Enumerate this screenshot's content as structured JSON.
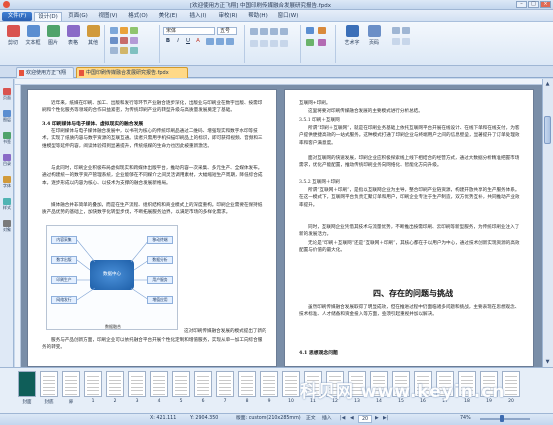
{
  "window": {
    "title": "[欢迎使用方正飞翔] 中国印刷传媒融合发展研究报告.fpdx"
  },
  "menu": {
    "file": "文件(F)",
    "tabs": [
      "设计(D)",
      "页面(G)",
      "视图(V)",
      "格式(O)",
      "美化(E)",
      "插入(I)",
      "审校(R)",
      "帮助(H)",
      "窗口(W)"
    ],
    "active_index": 0
  },
  "ribbon": {
    "buttons": [
      "剪切",
      "文本框",
      "图片",
      "表格",
      "其他"
    ],
    "font_name": "宋体",
    "font_size": "五号",
    "format": [
      "B",
      "I",
      "U",
      "A"
    ],
    "right_buttons": [
      "艺术字",
      "页码"
    ]
  },
  "doctabs": [
    {
      "label": "欢迎使用方正飞翔",
      "active": false
    },
    {
      "label": "中国印刷传媒融合发展研究报告.fpdx",
      "active": true
    }
  ],
  "leftpanel": [
    "页面",
    "图层",
    "书签",
    "目录",
    "字体",
    "样式",
    "对象"
  ],
  "page_left": {
    "intro": "近年来，纸媒在印刷、加工、出版和发行等环节产业融合逐步深化，出版业与印刷业在数字出版、按需印刷和个性化服务等领域的合作日益紧密，为传统印刷产业的转型升级与高质量发展奠定了基础。",
    "h_3_4": "3.4 印刷媒体与电子媒体、虚拟现实的融合发展",
    "p1": "在印刷媒体与电子媒体融合发展中，以书刊为核心的传统印刷品通过二维码、增强现实和数字水印等技术，实现了纸质内容与数字资源的互联互通。读者只需用手机扫描印刷品上的标识，即可获得视频、音频和三维模型等延伸内容，阅读体验得到显著提升，传统纸媒的生命力也因此被重新激活。",
    "p2": "与此同时，印刷企业积极布局虚拟现实和跨媒体出版平台，推动内容一次采集、多元生产、全媒体发布。通过构建统一的数字资产管理系统，企业能够在不同媒介之间灵活调用素材，大幅缩短生产周期，降低综合成本，逐步形成以内容为核心、以技术为支撑的融合发展新格局。",
    "p3": "媒体融合并非简单的叠加，而是在生产流程、组织结构和商业模式上的深度重构。印刷企业需要在保持纸质产品优势的基础上，加快数字化转型步伐，不断拓展服务边界，以满足市场的多样化需求。",
    "caption": "数据融合",
    "p4": "这对印刷传媒融合发展的模式提出了新的要求，需要产业链上下游协同推进。",
    "p5": "服务与产品创新方面，印刷企业可以依托融合平台开展个性化定制和增值服务，实现从单一加工向综合服务的转变。"
  },
  "diagram": {
    "center": "数据中心",
    "nodes": [
      "内容采集",
      "数字出版",
      "印刷生产",
      "网络发行",
      "移动终端",
      "数据分析",
      "用户服务",
      "增值应用"
    ]
  },
  "page_right": {
    "top": "互联网+印刷。",
    "p0": "这里将要对印刷传媒融合发展的主要模式进行分析总结。",
    "h_1": "3.5.1 印刷＋互联网",
    "p1": "所谓“印刷＋互联网”，就是在印刷业务基础上依托互联网平台开展在线设计、在线下单和在线支付，为客户提供便捷高效的一站式服务。这种模式打通了印刷企业与终端用户之间的信息壁垒，显著提升了订单处理效率和客户满意度。",
    "p2": "面对互联网的快速发展，印刷企业应积极探索线上线下相结合的经营方式，通过大数据分析精准把握市场需求，优化产能配置，推动传统印刷业务向网络化、智能化方向升级。",
    "h_2": "3.5.2 互联网＋印刷",
    "p3": "所谓“互联网＋印刷”，是指以互联网企业为主导，整合印刷产业链资源，构建开放共享的生产服务体系。在这一模式下，互联网平台负责汇聚订单和用户，印刷企业专注于生产制造，双方优势互补，共同推动产业效率提升。",
    "p4": "同时，互联网企业凭借其技术与流量优势，不断推出按需印刷、云印刷等新型服务，为传统印刷业注入了新的发展活力。",
    "p5": "无论是“印刷＋互联网”还是“互联网＋印刷”，其核心都在于以用户为中心，通过技术创新实现资源的高效配置与价值的最大化。",
    "h_big": "四、存在的问题与挑战",
    "p6": "虽然印刷传媒融合发展取得了明显成效，但在推进过程中仍面临诸多问题和挑战，主要表现在思想观念、技术标准、人才储备和资金投入等方面，亟须引起重视并加以解决。",
    "h_4_1": "4.1 思想观念问题"
  },
  "thumbnails": [
    "封面",
    "封底",
    "扉",
    "1",
    "2",
    "3",
    "4",
    "5",
    "6",
    "7",
    "8",
    "9",
    "10",
    "11",
    "12",
    "13",
    "14",
    "15",
    "16",
    "17",
    "18",
    "19",
    "20"
  ],
  "watermark": "科贝网 www.keyin.cn",
  "status": {
    "x": "X: 421.111",
    "y": "Y: 2904.350",
    "page_info": "版面: custom(210x285mm)",
    "mode": "正文",
    "insert": "插入",
    "page": "20",
    "zoom": "74%"
  }
}
